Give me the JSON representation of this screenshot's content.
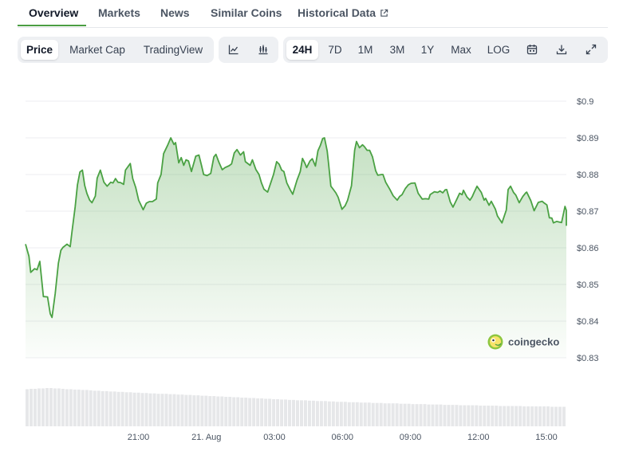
{
  "tabs": [
    {
      "label": "Overview",
      "active": true
    },
    {
      "label": "Markets"
    },
    {
      "label": "News"
    },
    {
      "label": "Similar Coins"
    },
    {
      "label": "Historical Data",
      "icon": "external-link-icon"
    }
  ],
  "toolbar": {
    "type_buttons": [
      {
        "label": "Price",
        "selected": true
      },
      {
        "label": "Market Cap"
      },
      {
        "label": "TradingView"
      }
    ],
    "chart_style_icons": [
      "line-chart-icon",
      "candlestick-chart-icon"
    ],
    "range_buttons": [
      {
        "label": "24H",
        "selected": true
      },
      {
        "label": "7D"
      },
      {
        "label": "1M"
      },
      {
        "label": "3M"
      },
      {
        "label": "1Y"
      },
      {
        "label": "Max"
      },
      {
        "label": "LOG"
      }
    ],
    "action_icons": [
      "calendar-icon",
      "download-icon",
      "fullscreen-icon"
    ]
  },
  "brand": {
    "label": "coingecko"
  },
  "colors": {
    "line": "#4aa143",
    "accent": "#4b9e43",
    "volume": "#e6e7e9"
  },
  "chart_data": {
    "type": "area",
    "ylim": [
      0.83,
      0.9
    ],
    "yticks": [
      "$0.9",
      "$0.89",
      "$0.88",
      "$0.87",
      "$0.86",
      "$0.85",
      "$0.84",
      "$0.83"
    ],
    "yvalues": [
      0.9,
      0.89,
      0.88,
      0.87,
      0.86,
      0.85,
      0.84,
      0.83
    ],
    "xticks": [
      "21:00",
      "21. Aug",
      "03:00",
      "06:00",
      "09:00",
      "12:00",
      "15:00"
    ],
    "xtick_hours": [
      21,
      24,
      27,
      30,
      33,
      36,
      39
    ],
    "xlim_hours": [
      16.02,
      39.88
    ],
    "series": [
      {
        "values": [
          [
            16.02,
            0.861
          ],
          [
            16.17,
            0.8577
          ],
          [
            16.25,
            0.8533
          ],
          [
            16.42,
            0.8543
          ],
          [
            16.53,
            0.854
          ],
          [
            16.65,
            0.8563
          ],
          [
            16.81,
            0.8467
          ],
          [
            16.99,
            0.8466
          ],
          [
            17.11,
            0.842
          ],
          [
            17.19,
            0.841
          ],
          [
            17.33,
            0.8475
          ],
          [
            17.47,
            0.8558
          ],
          [
            17.58,
            0.8593
          ],
          [
            17.67,
            0.8601
          ],
          [
            17.85,
            0.861
          ],
          [
            17.99,
            0.8603
          ],
          [
            18.07,
            0.8645
          ],
          [
            18.21,
            0.8711
          ],
          [
            18.31,
            0.8772
          ],
          [
            18.42,
            0.8807
          ],
          [
            18.53,
            0.8812
          ],
          [
            18.63,
            0.877
          ],
          [
            18.73,
            0.8748
          ],
          [
            18.85,
            0.873
          ],
          [
            18.95,
            0.8723
          ],
          [
            19.1,
            0.8741
          ],
          [
            19.18,
            0.879
          ],
          [
            19.32,
            0.8812
          ],
          [
            19.48,
            0.8779
          ],
          [
            19.62,
            0.8768
          ],
          [
            19.78,
            0.8779
          ],
          [
            19.88,
            0.8777
          ],
          [
            19.99,
            0.8789
          ],
          [
            20.1,
            0.8779
          ],
          [
            20.21,
            0.8778
          ],
          [
            20.35,
            0.8773
          ],
          [
            20.43,
            0.8812
          ],
          [
            20.64,
            0.883
          ],
          [
            20.75,
            0.8789
          ],
          [
            20.88,
            0.8765
          ],
          [
            21.01,
            0.873
          ],
          [
            21.21,
            0.8704
          ],
          [
            21.35,
            0.8722
          ],
          [
            21.48,
            0.8726
          ],
          [
            21.62,
            0.8726
          ],
          [
            21.79,
            0.8733
          ],
          [
            21.85,
            0.8777
          ],
          [
            22.0,
            0.88
          ],
          [
            22.11,
            0.8857
          ],
          [
            22.29,
            0.888
          ],
          [
            22.43,
            0.89
          ],
          [
            22.57,
            0.8882
          ],
          [
            22.64,
            0.8887
          ],
          [
            22.78,
            0.8832
          ],
          [
            22.89,
            0.8846
          ],
          [
            23.0,
            0.8825
          ],
          [
            23.1,
            0.884
          ],
          [
            23.21,
            0.8837
          ],
          [
            23.34,
            0.8808
          ],
          [
            23.53,
            0.885
          ],
          [
            23.67,
            0.8853
          ],
          [
            23.79,
            0.8823
          ],
          [
            23.88,
            0.88
          ],
          [
            24.03,
            0.8797
          ],
          [
            24.19,
            0.8803
          ],
          [
            24.33,
            0.8848
          ],
          [
            24.42,
            0.8855
          ],
          [
            24.56,
            0.8832
          ],
          [
            24.7,
            0.8813
          ],
          [
            24.82,
            0.8819
          ],
          [
            25.0,
            0.8824
          ],
          [
            25.11,
            0.8829
          ],
          [
            25.23,
            0.8859
          ],
          [
            25.35,
            0.8868
          ],
          [
            25.5,
            0.8853
          ],
          [
            25.64,
            0.8862
          ],
          [
            25.72,
            0.8835
          ],
          [
            25.93,
            0.8825
          ],
          [
            26.03,
            0.884
          ],
          [
            26.18,
            0.8814
          ],
          [
            26.32,
            0.88
          ],
          [
            26.43,
            0.8777
          ],
          [
            26.54,
            0.876
          ],
          [
            26.7,
            0.8752
          ],
          [
            26.86,
            0.8781
          ],
          [
            26.96,
            0.88
          ],
          [
            27.1,
            0.8835
          ],
          [
            27.21,
            0.8828
          ],
          [
            27.32,
            0.8812
          ],
          [
            27.42,
            0.8808
          ],
          [
            27.55,
            0.8777
          ],
          [
            27.7,
            0.8758
          ],
          [
            27.81,
            0.8746
          ],
          [
            28.0,
            0.8785
          ],
          [
            28.14,
            0.8808
          ],
          [
            28.24,
            0.8844
          ],
          [
            28.35,
            0.883
          ],
          [
            28.42,
            0.8819
          ],
          [
            28.57,
            0.8837
          ],
          [
            28.67,
            0.8843
          ],
          [
            28.81,
            0.8823
          ],
          [
            28.92,
            0.8865
          ],
          [
            29.03,
            0.888
          ],
          [
            29.13,
            0.8898
          ],
          [
            29.21,
            0.89
          ],
          [
            29.33,
            0.8864
          ],
          [
            29.39,
            0.883
          ],
          [
            29.49,
            0.8768
          ],
          [
            29.57,
            0.8762
          ],
          [
            29.71,
            0.875
          ],
          [
            29.81,
            0.8738
          ],
          [
            29.98,
            0.8705
          ],
          [
            30.12,
            0.8715
          ],
          [
            30.23,
            0.873
          ],
          [
            30.33,
            0.8753
          ],
          [
            30.4,
            0.8769
          ],
          [
            30.54,
            0.8866
          ],
          [
            30.62,
            0.889
          ],
          [
            30.75,
            0.8873
          ],
          [
            30.89,
            0.8881
          ],
          [
            30.97,
            0.8876
          ],
          [
            31.09,
            0.8866
          ],
          [
            31.2,
            0.8866
          ],
          [
            31.33,
            0.8848
          ],
          [
            31.47,
            0.881
          ],
          [
            31.56,
            0.8798
          ],
          [
            31.73,
            0.88
          ],
          [
            31.79,
            0.88
          ],
          [
            31.91,
            0.8779
          ],
          [
            32.09,
            0.876
          ],
          [
            32.24,
            0.8742
          ],
          [
            32.42,
            0.873
          ],
          [
            32.52,
            0.874
          ],
          [
            32.63,
            0.8745
          ],
          [
            32.78,
            0.8762
          ],
          [
            32.91,
            0.8772
          ],
          [
            33.03,
            0.8776
          ],
          [
            33.2,
            0.8777
          ],
          [
            33.34,
            0.8749
          ],
          [
            33.52,
            0.8733
          ],
          [
            33.66,
            0.8734
          ],
          [
            33.81,
            0.8733
          ],
          [
            33.87,
            0.8745
          ],
          [
            34.06,
            0.8753
          ],
          [
            34.2,
            0.8751
          ],
          [
            34.31,
            0.8755
          ],
          [
            34.43,
            0.875
          ],
          [
            34.53,
            0.8758
          ],
          [
            34.6,
            0.8759
          ],
          [
            34.76,
            0.8725
          ],
          [
            34.88,
            0.8711
          ],
          [
            35.05,
            0.8733
          ],
          [
            35.17,
            0.8749
          ],
          [
            35.28,
            0.8745
          ],
          [
            35.34,
            0.8757
          ],
          [
            35.49,
            0.8739
          ],
          [
            35.63,
            0.873
          ],
          [
            35.73,
            0.874
          ],
          [
            35.8,
            0.875
          ],
          [
            35.94,
            0.8768
          ],
          [
            36.13,
            0.8751
          ],
          [
            36.25,
            0.873
          ],
          [
            36.32,
            0.8735
          ],
          [
            36.47,
            0.8716
          ],
          [
            36.57,
            0.8727
          ],
          [
            36.75,
            0.8705
          ],
          [
            36.84,
            0.8687
          ],
          [
            37.04,
            0.8668
          ],
          [
            37.23,
            0.8703
          ],
          [
            37.31,
            0.8759
          ],
          [
            37.42,
            0.8768
          ],
          [
            37.55,
            0.8751
          ],
          [
            37.65,
            0.8744
          ],
          [
            37.8,
            0.8723
          ],
          [
            37.96,
            0.874
          ],
          [
            38.09,
            0.875
          ],
          [
            38.13,
            0.8752
          ],
          [
            38.31,
            0.8729
          ],
          [
            38.46,
            0.8701
          ],
          [
            38.64,
            0.8724
          ],
          [
            38.81,
            0.8727
          ],
          [
            38.91,
            0.8722
          ],
          [
            39.02,
            0.8717
          ],
          [
            39.13,
            0.8682
          ],
          [
            39.24,
            0.8681
          ],
          [
            39.31,
            0.8668
          ],
          [
            39.45,
            0.8672
          ],
          [
            39.58,
            0.867
          ],
          [
            39.67,
            0.8669
          ],
          [
            39.82,
            0.8713
          ],
          [
            39.89,
            0.8702
          ],
          [
            39.96,
            0.867
          ],
          [
            40.05,
            0.866
          ]
        ]
      }
    ],
    "volume": {
      "note_scale": "relative",
      "values": [
        0.97,
        0.98,
        0.98,
        0.99,
        0.99,
        1.0,
        1.0,
        0.99,
        0.99,
        0.98,
        0.97,
        0.97,
        0.96,
        0.96,
        0.95,
        0.95,
        0.94,
        0.93,
        0.93,
        0.92,
        0.92,
        0.91,
        0.91,
        0.9,
        0.9,
        0.89,
        0.89,
        0.88,
        0.88,
        0.87,
        0.87,
        0.86,
        0.86,
        0.85,
        0.85,
        0.85,
        0.84,
        0.84,
        0.83,
        0.83,
        0.82,
        0.82,
        0.81,
        0.81,
        0.8,
        0.8,
        0.79,
        0.79,
        0.78,
        0.78,
        0.77,
        0.77,
        0.76,
        0.76,
        0.75,
        0.75,
        0.74,
        0.74,
        0.73,
        0.73,
        0.72,
        0.72,
        0.71,
        0.71,
        0.7,
        0.7,
        0.69,
        0.69,
        0.68,
        0.68,
        0.68,
        0.67,
        0.67,
        0.66,
        0.66,
        0.66,
        0.65,
        0.65,
        0.64,
        0.64,
        0.64,
        0.63,
        0.63,
        0.63,
        0.62,
        0.62,
        0.62,
        0.61,
        0.61,
        0.61,
        0.6,
        0.6,
        0.6,
        0.6,
        0.59,
        0.59,
        0.59,
        0.58,
        0.58,
        0.58,
        0.58,
        0.57,
        0.57,
        0.57,
        0.57,
        0.56,
        0.56,
        0.56,
        0.56,
        0.55,
        0.55,
        0.55,
        0.55,
        0.55,
        0.54,
        0.54,
        0.54,
        0.54,
        0.54,
        0.53,
        0.53,
        0.53,
        0.53,
        0.53,
        0.53,
        0.52,
        0.52,
        0.52,
        0.52,
        0.52,
        0.52,
        0.52,
        0.51,
        0.51,
        0.51,
        0.51
      ]
    }
  }
}
